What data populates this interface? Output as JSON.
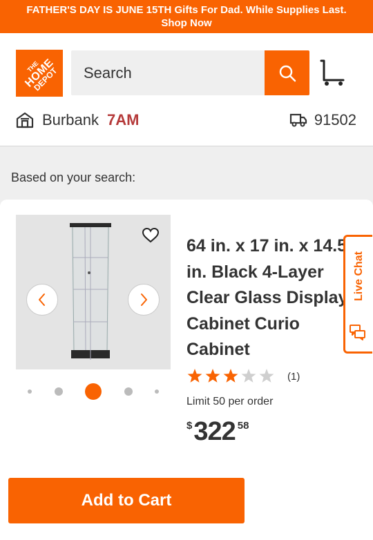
{
  "banner": {
    "line1": "FATHER'S DAY IS JUNE 15TH Gifts For Dad. While Supplies Last.",
    "line2": "Shop Now"
  },
  "header": {
    "logo": {
      "line1": "THE",
      "line2": "HOME",
      "line3": "DEPOT"
    },
    "search_placeholder": "Search",
    "icons": {
      "search": "search-icon",
      "cart": "cart-icon",
      "store": "store-icon",
      "truck": "truck-icon"
    },
    "store_name": "Burbank",
    "store_time": "7AM",
    "zip": "91502"
  },
  "results": {
    "heading": "Based on your search:"
  },
  "product": {
    "title": "64 in. x 17 in. x 14.5 in. Black 4-Layer Clear Glass Display Cabinet Curio Cabinet",
    "rating": 3,
    "rating_max": 5,
    "review_count": "(1)",
    "limit": "Limit 50 per order",
    "price_currency": "$",
    "price_dollars": "322",
    "price_cents": "58",
    "image_dots": 5,
    "active_dot": 2
  },
  "actions": {
    "add_to_cart": "Add to Cart"
  },
  "live_chat": {
    "label": "Live Chat"
  },
  "colors": {
    "brand_orange": "#f96302",
    "star_fill": "#f96302",
    "store_time": "#b53a3a"
  }
}
